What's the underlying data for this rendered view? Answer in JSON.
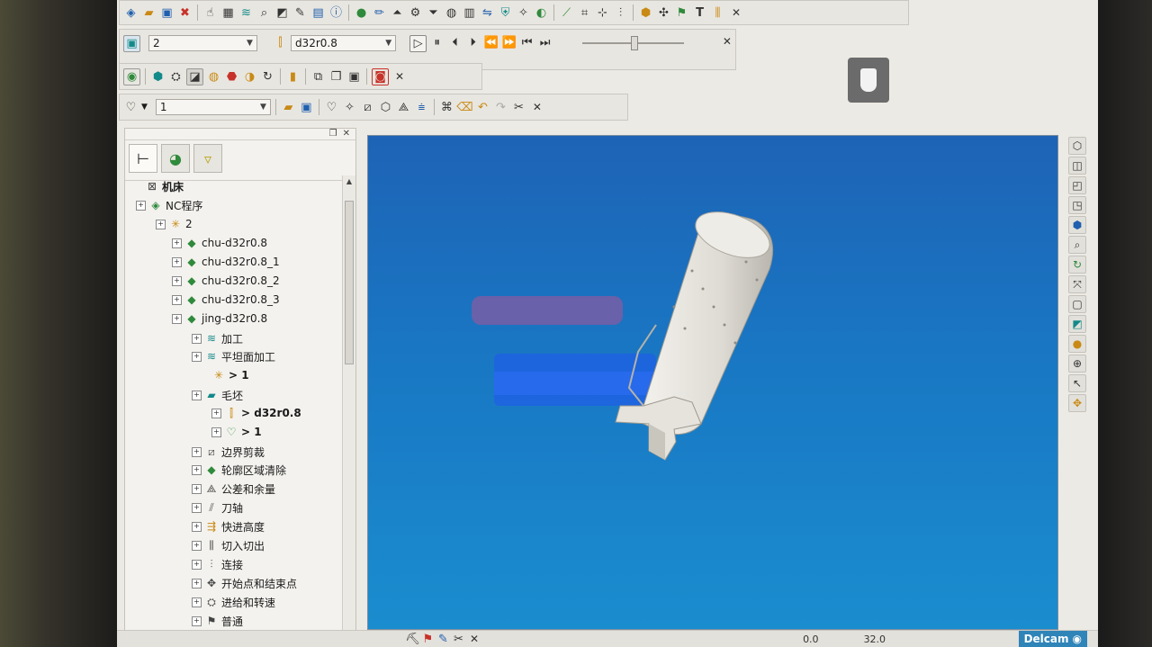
{
  "toolbar1": {
    "icons": [
      "cube-view",
      "open-folder",
      "save",
      "delete",
      "cursor",
      "grid",
      "layers",
      "zoom-select",
      "render",
      "edit",
      "calendar",
      "info",
      "sphere",
      "pen",
      "triangle",
      "gear",
      "arrow-down",
      "nc-output",
      "table",
      "level-set",
      "shield",
      "wand",
      "curve",
      "line",
      "tool-path",
      "split",
      "box",
      "block",
      "wrench",
      "text-tool",
      "ruler"
    ],
    "text_tool_label": "T"
  },
  "toolbar2": {
    "toolpath_select": "2",
    "tool_select": "d32r0.8",
    "playback_icons": [
      "play-arrow",
      "pause",
      "step-back",
      "step-forward",
      "rewind",
      "fast-forward",
      "to-start",
      "to-end"
    ],
    "slider_level": 0.48
  },
  "toolbar3": {
    "icons": [
      "shade-sphere",
      "solid-block",
      "machine",
      "plain-shading",
      "mesh",
      "multi-color",
      "half-color",
      "colormap",
      "export",
      "extract",
      "copy-block",
      "save-block",
      "stop-sim"
    ]
  },
  "toolbar4": {
    "pattern_select": "1",
    "icons": [
      "open",
      "save",
      "curve-a",
      "curve-b",
      "curve-c",
      "curve-d",
      "curve-e",
      "stamp",
      "edit-curve",
      "eraser",
      "undo",
      "redo",
      "scissors"
    ]
  },
  "tree": {
    "items": [
      {
        "label": "机床",
        "bold": true
      },
      {
        "label": "NC程序",
        "bold": false
      },
      {
        "label": "2",
        "bold": false
      },
      {
        "label": "chu-d32r0.8",
        "bold": false
      },
      {
        "label": "chu-d32r0.8_1",
        "bold": false
      },
      {
        "label": "chu-d32r0.8_2",
        "bold": false
      },
      {
        "label": "chu-d32r0.8_3",
        "bold": false
      },
      {
        "label": "jing-d32r0.8",
        "bold": false
      },
      {
        "label": "加工",
        "bold": false
      },
      {
        "label": "平坦面加工",
        "bold": false
      },
      {
        "label": "> 1",
        "bold": true
      },
      {
        "label": "毛坯",
        "bold": false
      },
      {
        "label": "> d32r0.8",
        "bold": true
      },
      {
        "label": "> 1",
        "bold": true
      },
      {
        "label": "边界剪裁",
        "bold": false
      },
      {
        "label": "轮廓区域清除",
        "bold": false
      },
      {
        "label": "公差和余量",
        "bold": false
      },
      {
        "label": "刀轴",
        "bold": false
      },
      {
        "label": "快进高度",
        "bold": false
      },
      {
        "label": "切入切出",
        "bold": false
      },
      {
        "label": "连接",
        "bold": false
      },
      {
        "label": "开始点和结束点",
        "bold": false
      },
      {
        "label": "进给和转速",
        "bold": false
      },
      {
        "label": "普通",
        "bold": false
      }
    ]
  },
  "status": {
    "brand": "Delcam",
    "value_a": "0.0",
    "value_b": "32.0"
  },
  "colors": {
    "viewport_top": "#1e63b6",
    "viewport_bottom": "#1a8dcf",
    "stock": "#e8e6df",
    "tool_blue": "#1f5fe6",
    "tool_purple": "#8b5aa0"
  }
}
